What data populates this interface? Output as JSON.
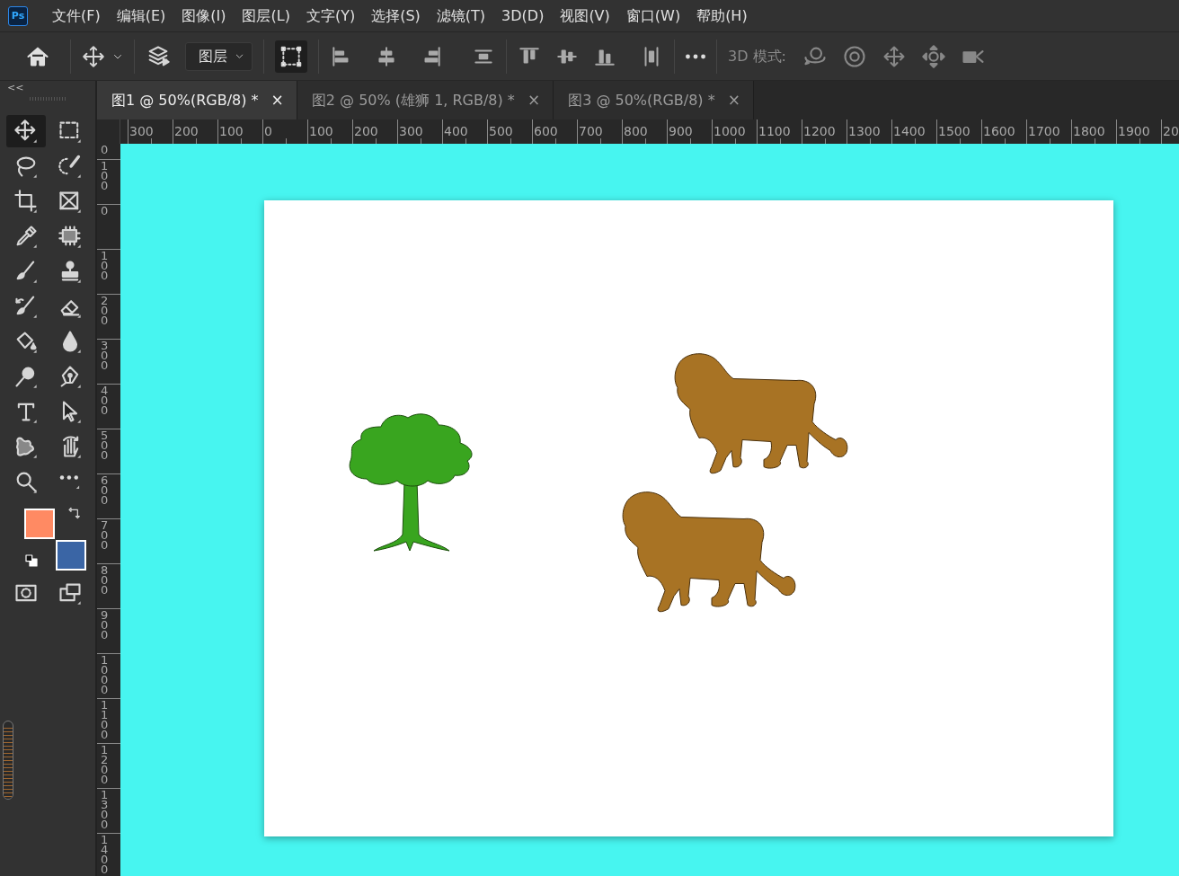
{
  "app": {
    "logo": "Ps"
  },
  "menu": [
    "文件(F)",
    "编辑(E)",
    "图像(I)",
    "图层(L)",
    "文字(Y)",
    "选择(S)",
    "滤镜(T)",
    "3D(D)",
    "视图(V)",
    "窗口(W)",
    "帮助(H)"
  ],
  "options_bar": {
    "layer_select": "图层",
    "transform_controls": {
      "on": true
    },
    "mode_label": "3D 模式:"
  },
  "panel_toggle": "<<",
  "tabs": [
    {
      "label": "图1 @ 50%(RGB/8) *",
      "close": "×",
      "selected": true
    },
    {
      "label": "图2 @ 50% (雄狮 1, RGB/8) *",
      "close": "×",
      "selected": false
    },
    {
      "label": "图3 @ 50%(RGB/8) *",
      "close": "×",
      "selected": false
    }
  ],
  "rulers": {
    "horizontal": [
      "300",
      "200",
      "100",
      "0",
      "100",
      "200",
      "300",
      "400",
      "500",
      "600",
      "700",
      "800",
      "900",
      "1000",
      "1100",
      "1200",
      "1300",
      "1400",
      "1500",
      "1600",
      "1700",
      "1800",
      "1900",
      "20"
    ],
    "vertical": [
      "0",
      "100",
      "0",
      "100",
      "200",
      "300",
      "400",
      "500",
      "600",
      "700",
      "800",
      "900",
      "1000",
      "1100",
      "1200",
      "1300",
      "1400"
    ]
  },
  "tools": [
    {
      "selected": true
    },
    {
      "selected": false
    },
    {
      "selected": false
    },
    {
      "selected": false
    },
    {
      "selected": false
    },
    {
      "selected": false
    },
    {
      "selected": false
    },
    {
      "selected": false
    },
    {
      "selected": false
    },
    {
      "selected": false
    },
    {
      "selected": false
    },
    {
      "selected": false
    },
    {
      "selected": false
    },
    {
      "selected": false
    },
    {
      "selected": false
    },
    {
      "selected": false
    },
    {
      "selected": false
    },
    {
      "selected": false
    },
    {
      "selected": false
    },
    {
      "selected": false
    },
    {
      "selected": false
    },
    {
      "selected": false
    }
  ],
  "swatches": [
    {
      "color": "#ff8a63"
    },
    {
      "color": "#3a65a5"
    }
  ],
  "dock_scrubber": {
    "level": 0.92
  }
}
